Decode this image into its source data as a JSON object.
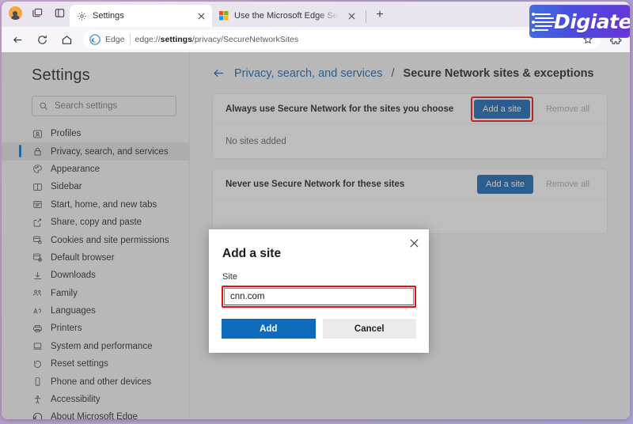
{
  "browser": {
    "tabs": [
      {
        "title": "Settings",
        "icon": "gear-icon",
        "active": true
      },
      {
        "title": "Use the Microsoft Edge Secure N",
        "icon": "microsoft-icon",
        "active": false
      }
    ],
    "new_tab_label": "+",
    "toolbar": {
      "back_label": "Back",
      "refresh_label": "Refresh",
      "home_label": "Home",
      "omnibox_brand": "Edge",
      "url_prefix": "edge://",
      "url_bold": "settings",
      "url_suffix": "/privacy/SecureNetworkSites",
      "favorite_label": "Add this page to favorites",
      "extensions_label": "Extensions"
    },
    "logo": {
      "text": "igiatech",
      "initial": "D"
    }
  },
  "sidebar": {
    "title": "Settings",
    "search": {
      "placeholder": "Search settings",
      "value": ""
    },
    "items": [
      {
        "label": "Profiles",
        "icon": "profile-icon",
        "selected": false
      },
      {
        "label": "Privacy, search, and services",
        "icon": "lock-icon",
        "selected": true
      },
      {
        "label": "Appearance",
        "icon": "palette-icon",
        "selected": false
      },
      {
        "label": "Sidebar",
        "icon": "sidebar-icon",
        "selected": false
      },
      {
        "label": "Start, home, and new tabs",
        "icon": "window-icon",
        "selected": false
      },
      {
        "label": "Share, copy and paste",
        "icon": "share-icon",
        "selected": false
      },
      {
        "label": "Cookies and site permissions",
        "icon": "cookies-icon",
        "selected": false
      },
      {
        "label": "Default browser",
        "icon": "default-browser-icon",
        "selected": false
      },
      {
        "label": "Downloads",
        "icon": "download-icon",
        "selected": false
      },
      {
        "label": "Family",
        "icon": "family-icon",
        "selected": false
      },
      {
        "label": "Languages",
        "icon": "language-icon",
        "selected": false
      },
      {
        "label": "Printers",
        "icon": "printer-icon",
        "selected": false
      },
      {
        "label": "System and performance",
        "icon": "laptop-icon",
        "selected": false
      },
      {
        "label": "Reset settings",
        "icon": "reset-icon",
        "selected": false
      },
      {
        "label": "Phone and other devices",
        "icon": "phone-icon",
        "selected": false
      },
      {
        "label": "Accessibility",
        "icon": "accessibility-icon",
        "selected": false
      },
      {
        "label": "About Microsoft Edge",
        "icon": "edge-icon",
        "selected": false
      }
    ]
  },
  "main": {
    "breadcrumb": {
      "back_icon": "back-arrow-icon",
      "parent": "Privacy, search, and services",
      "separator": "/",
      "current": "Secure Network sites & exceptions"
    },
    "cards": [
      {
        "heading": "Always use Secure Network for the sites you choose",
        "add_label": "Add a site",
        "remove_label": "Remove all",
        "empty_text": "No sites added",
        "add_highlighted": true
      },
      {
        "heading": "Never use Secure Network for these sites",
        "add_label": "Add a site",
        "remove_label": "Remove all",
        "empty_text": "",
        "add_highlighted": false
      }
    ]
  },
  "dialog": {
    "title": "Add a site",
    "close_icon": "close-icon",
    "field_label": "Site",
    "input_value": "cnn.com",
    "input_placeholder": "",
    "add_label": "Add",
    "cancel_label": "Cancel"
  },
  "colors": {
    "accent_blue": "#0f62b0",
    "dialog_add_blue": "#0f6cbd",
    "highlight_red": "#e81010",
    "selected_nav": "#e0e0e0"
  }
}
